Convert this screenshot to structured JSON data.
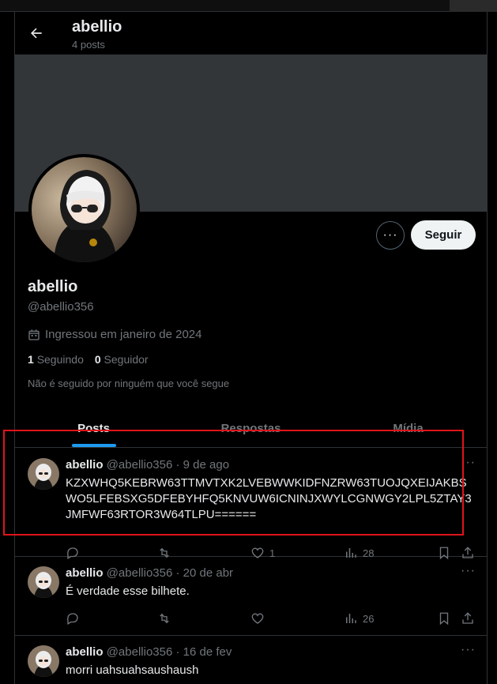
{
  "header": {
    "name": "abellio",
    "post_count": "4 posts"
  },
  "profile": {
    "name": "abellio",
    "handle": "@abellio356",
    "joined": "Ingressou em janeiro de 2024",
    "following_count": "1",
    "following_label": "Seguindo",
    "followers_count": "0",
    "followers_label": "Seguidor",
    "not_followed": "Não é seguido por ninguém que você segue",
    "follow_label": "Seguir",
    "more_label": "···"
  },
  "tabs": [
    {
      "label": "Posts",
      "active": true
    },
    {
      "label": "Respostas",
      "active": false
    },
    {
      "label": "Mídia",
      "active": false
    }
  ],
  "posts": [
    {
      "name": "abellio",
      "handle": "@abellio356",
      "sep": "·",
      "date": "9 de ago",
      "text": "KZXWHQ5KEBRW63TTMVTXK2LVEBWWKIDFNZRW63TUOJQXEIJAKBSWO5LFEBSXG5DFEBYHFQ5KNVUW6ICNINJXWYLCGNWGY2LPL5ZTAY3JMFWF63RTOR3W64TLPU======",
      "likes": "1",
      "views": "28"
    },
    {
      "name": "abellio",
      "handle": "@abellio356",
      "sep": "·",
      "date": "20 de abr",
      "text": "É verdade esse bilhete.",
      "likes": "",
      "views": "26"
    },
    {
      "name": "abellio",
      "handle": "@abellio356",
      "sep": "·",
      "date": "16 de fev",
      "text": "morri uahsuahsaushaush",
      "likes": "",
      "views": ""
    }
  ],
  "icons": [
    "back-arrow-icon",
    "calendar-icon",
    "more-icon",
    "reply-icon",
    "retweet-icon",
    "like-icon",
    "views-icon",
    "bookmark-icon",
    "share-icon"
  ],
  "colors": {
    "accent": "#1d9bf0",
    "highlight": "#e0141b",
    "banner": "#333639"
  }
}
